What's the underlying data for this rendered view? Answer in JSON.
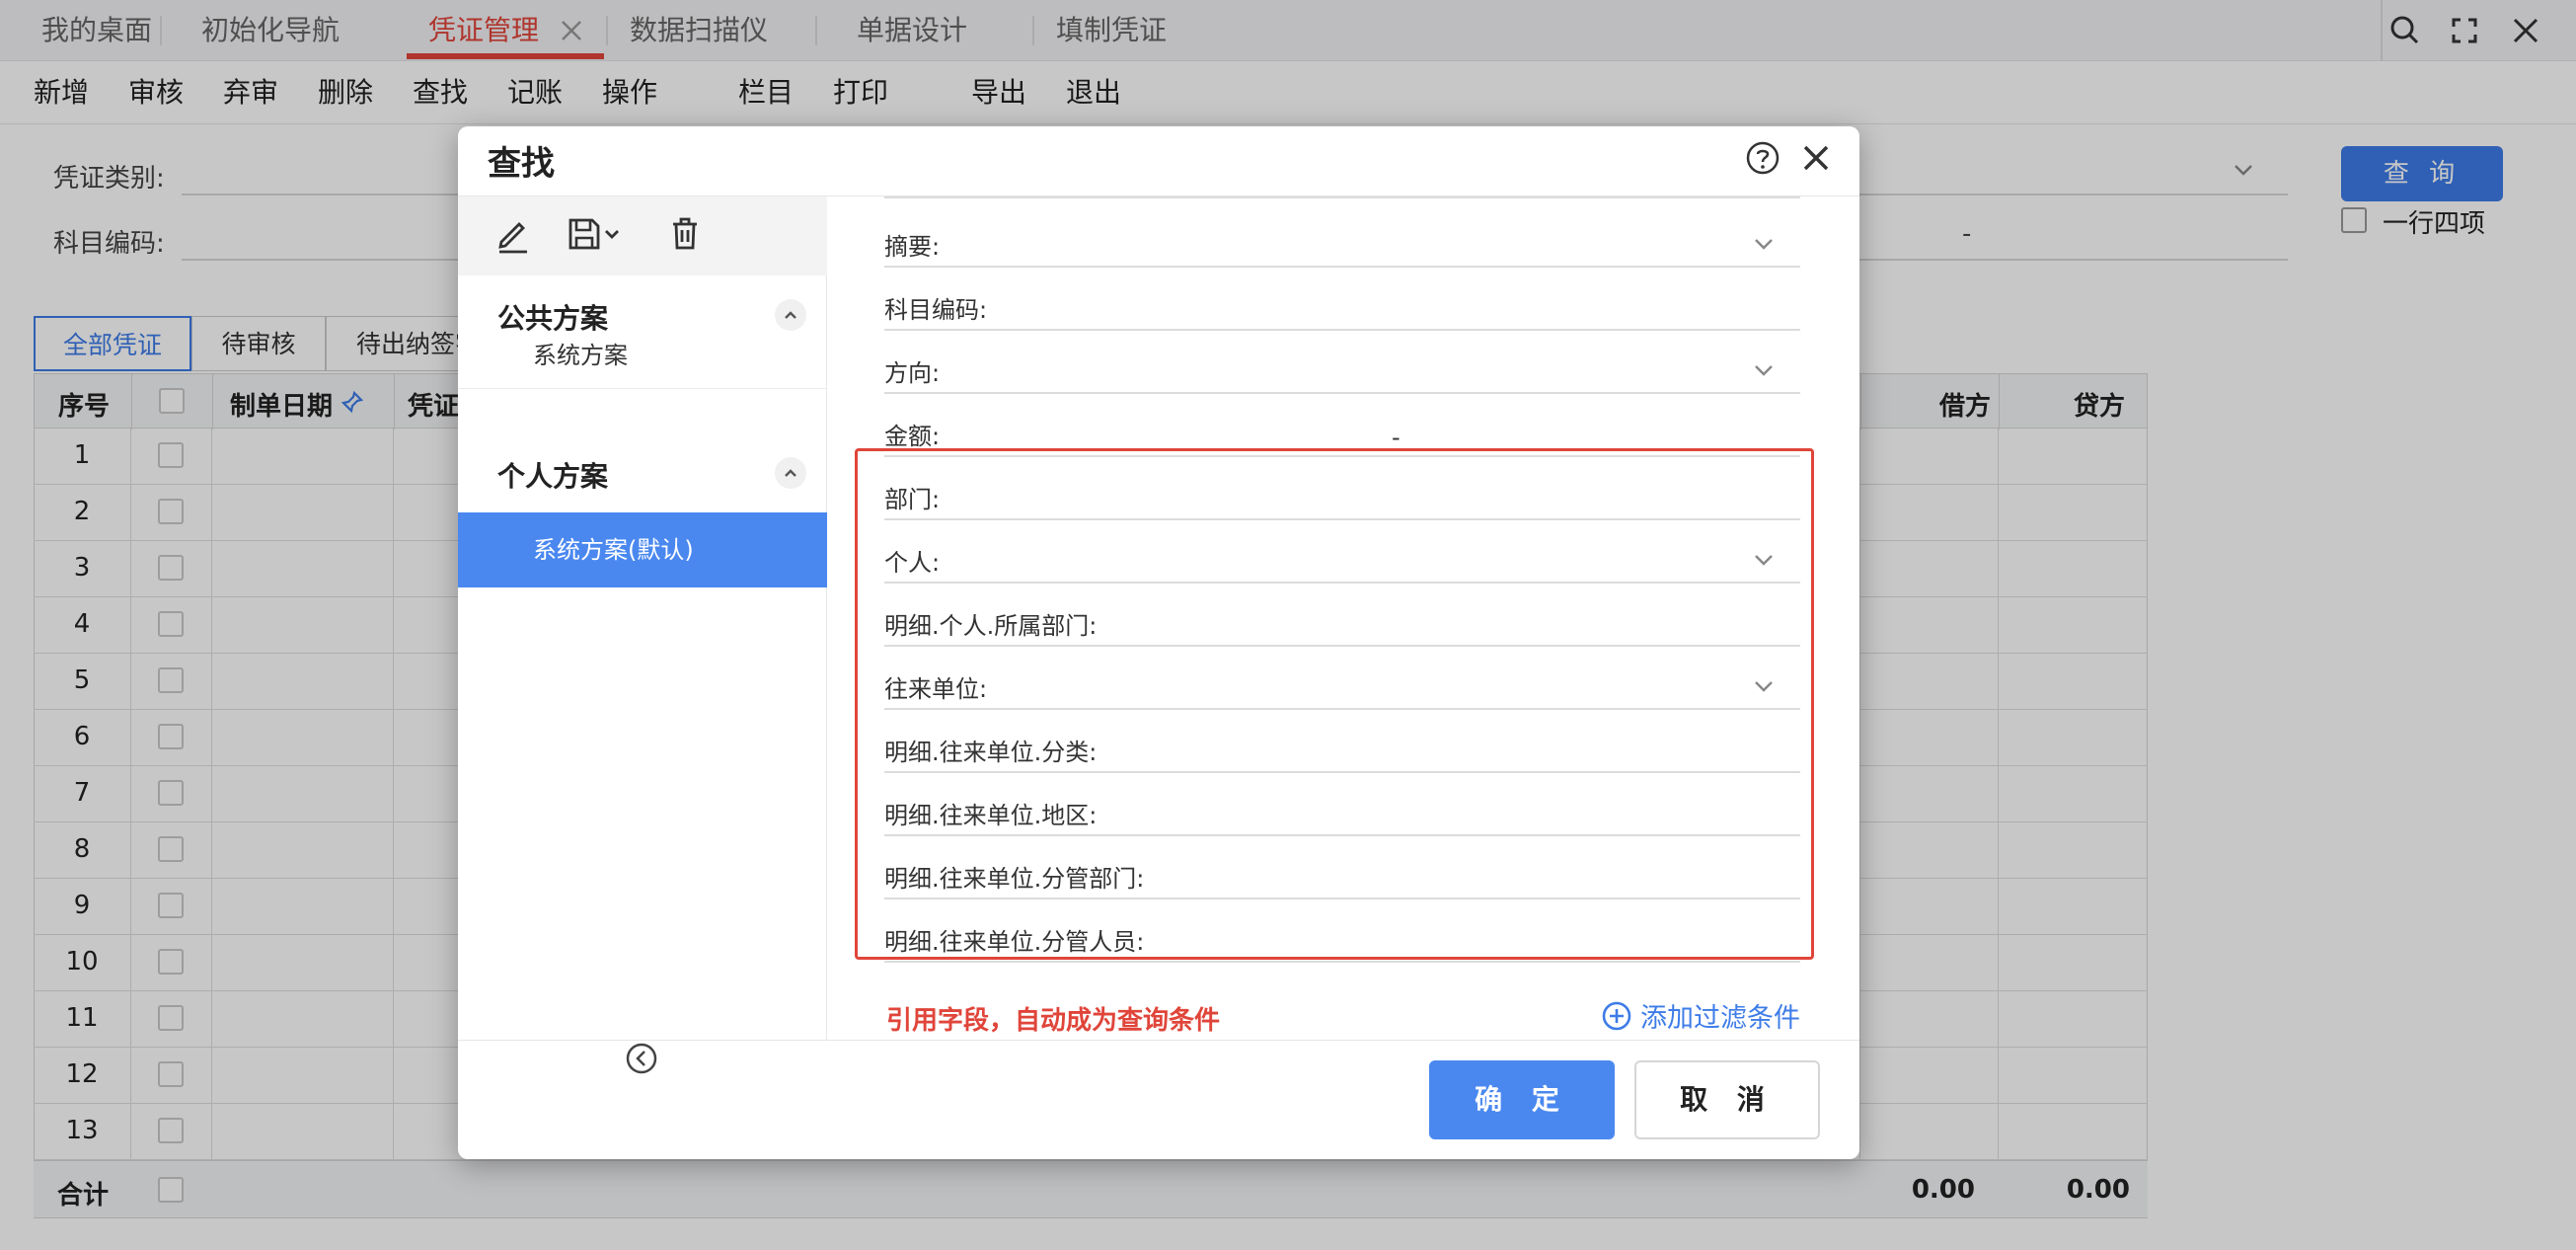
{
  "tabs": [
    {
      "label": "我的桌面"
    },
    {
      "label": "初始化导航"
    },
    {
      "label": "凭证管理"
    },
    {
      "label": "数据扫描仪"
    },
    {
      "label": "单据设计"
    },
    {
      "label": "填制凭证"
    }
  ],
  "window_icons": [
    "search-icon",
    "fullscreen-icon",
    "close-icon"
  ],
  "toolbar": {
    "add": "新增",
    "audit": "审核",
    "abandon": "弃审",
    "delete": "删除",
    "find": "查找",
    "post": "记账",
    "operate": "操作",
    "columns": "栏目",
    "print": "打印",
    "export": "导出",
    "exit": "退出"
  },
  "search": {
    "voucher_type_label": "凭证类别:",
    "subject_code_label": "科目编码:",
    "range_dash": "-",
    "query_button": "查 询",
    "one_row_four": "一行四项"
  },
  "status_tabs": [
    "全部凭证",
    "待审核",
    "待出纳签字"
  ],
  "grid": {
    "headers": {
      "seq": "序号",
      "date": "制单日期",
      "voucher": "凭证",
      "debit": "借方",
      "credit": "贷方"
    },
    "rows": [
      "1",
      "2",
      "3",
      "4",
      "5",
      "6",
      "7",
      "8",
      "9",
      "10",
      "11",
      "12",
      "13"
    ],
    "total_label": "合计",
    "total_debit": "0.00",
    "total_credit": "0.00"
  },
  "dialog": {
    "title": "查找",
    "public_section": "公共方案",
    "public_items": [
      "系统方案"
    ],
    "personal_section": "个人方案",
    "personal_items": [
      "系统方案(默认)"
    ],
    "fields": [
      {
        "label": "摘要:",
        "dropdown": true
      },
      {
        "label": "科目编码:",
        "dropdown": false
      },
      {
        "label": "方向:",
        "dropdown": true
      },
      {
        "label": "金额:",
        "dropdown": false
      },
      {
        "label": "部门:",
        "dropdown": false
      },
      {
        "label": "个人:",
        "dropdown": true
      },
      {
        "label": "明细.个人.所属部门:",
        "dropdown": false
      },
      {
        "label": "往来单位:",
        "dropdown": true
      },
      {
        "label": "明细.往来单位.分类:",
        "dropdown": false
      },
      {
        "label": "明细.往来单位.地区:",
        "dropdown": false
      },
      {
        "label": "明细.往来单位.分管部门:",
        "dropdown": false
      },
      {
        "label": "明细.往来单位.分管人员:",
        "dropdown": false
      }
    ],
    "amount_dash": "-",
    "hint": "引用字段，自动成为查询条件",
    "add_filter": "添加过滤条件",
    "ok": "确 定",
    "cancel": "取 消"
  },
  "colors": {
    "accent": "#3d7ce8",
    "active_tab": "#e0453a",
    "highlight_box": "#e0453a"
  }
}
